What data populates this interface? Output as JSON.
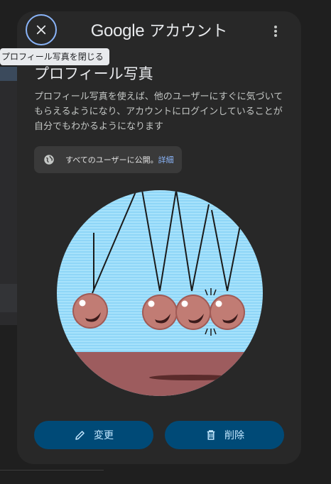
{
  "header": {
    "brand": "Google",
    "title_suffix": "アカウント",
    "close_tooltip": "プロフィール写真を閉じる"
  },
  "profile": {
    "title": "プロフィール写真",
    "description": "プロフィール写真を使えば、他のユーザーにすぐに気づいてもらえるようになり、アカウントにログインしていることが自分でもわかるようになります",
    "visibility_text": "すべてのユーザーに公開。",
    "visibility_link": "詳細"
  },
  "actions": {
    "edit_label": "変更",
    "delete_label": "削除"
  },
  "icons": {
    "close": "close-icon",
    "more": "more-vert-icon",
    "globe": "globe-icon",
    "edit": "pencil-icon",
    "delete": "trash-icon"
  },
  "colors": {
    "dialog_bg": "#282828",
    "button_bg": "#004a77",
    "button_text": "#c2e7ff",
    "link": "#8ab4f8",
    "focus_ring": "#8ab4f8"
  }
}
